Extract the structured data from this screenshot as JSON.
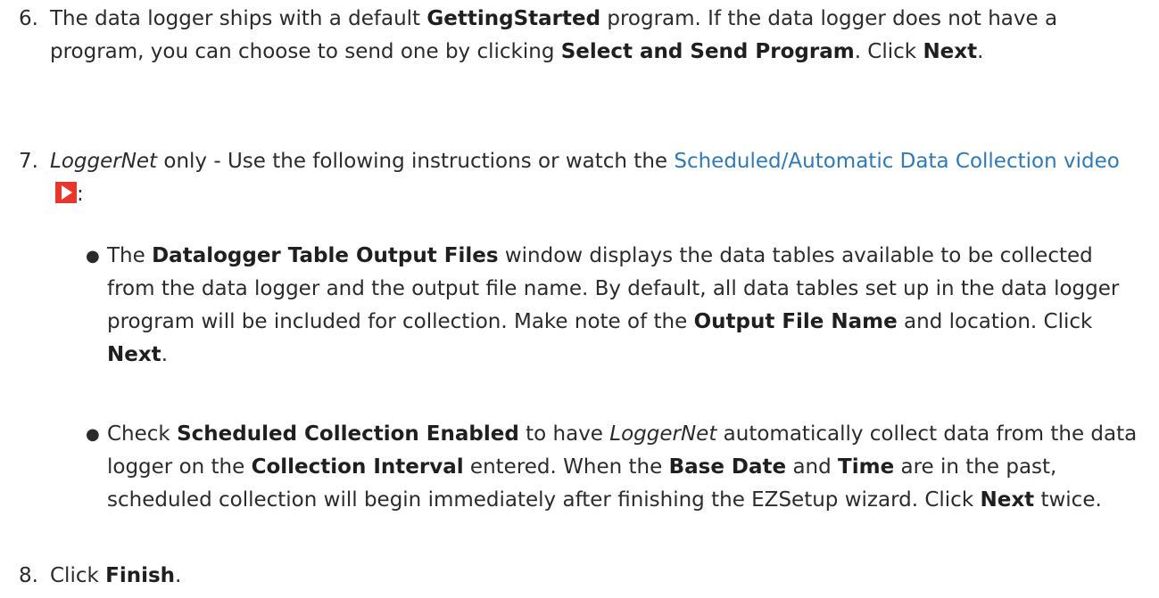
{
  "step6": {
    "number": "6.",
    "t1": "The data logger ships with a default ",
    "b1": "GettingStarted",
    "t2": " program. If the data logger does not have a program, you can choose to send one by clicking ",
    "b2": "Select and Send Program",
    "t3": ". Click ",
    "b3": "Next",
    "t4": "."
  },
  "step7": {
    "number": "7.",
    "i1": "LoggerNet",
    "t1": " only - Use the following instructions or watch the ",
    "link": "Scheduled/Automatic Data Collection video",
    "t2": ":",
    "icon": "play-video-icon",
    "bullets": [
      {
        "t1": "The ",
        "b1": "Datalogger Table Output Files",
        "t2": " window displays the data tables available to be collected from the data logger and the output file name. By default, all data tables set up in the data logger program will be included for collection. Make note of the ",
        "b2": "Output File Name",
        "t3": " and location. Click ",
        "b3": "Next",
        "t4": "."
      },
      {
        "t1": "Check ",
        "b1": "Scheduled Collection Enabled",
        "t2": " to have ",
        "i1": "LoggerNet",
        "t3": " automatically collect data from the data logger on the ",
        "b2": "Collection Interval",
        "t4": " entered. When the ",
        "b3": "Base Date",
        "t5": " and ",
        "b4": "Time",
        "t6": " are in the past, scheduled collection will begin immediately after finishing the EZSetup wizard. Click ",
        "b5": "Next",
        "t7": " twice."
      }
    ]
  },
  "step8": {
    "number": "8.",
    "t1": "Click ",
    "b1": "Finish",
    "t2": "."
  },
  "colors": {
    "text": "#2b2b2b",
    "link": "#2e7ab8",
    "video_icon": "#e8372a"
  }
}
